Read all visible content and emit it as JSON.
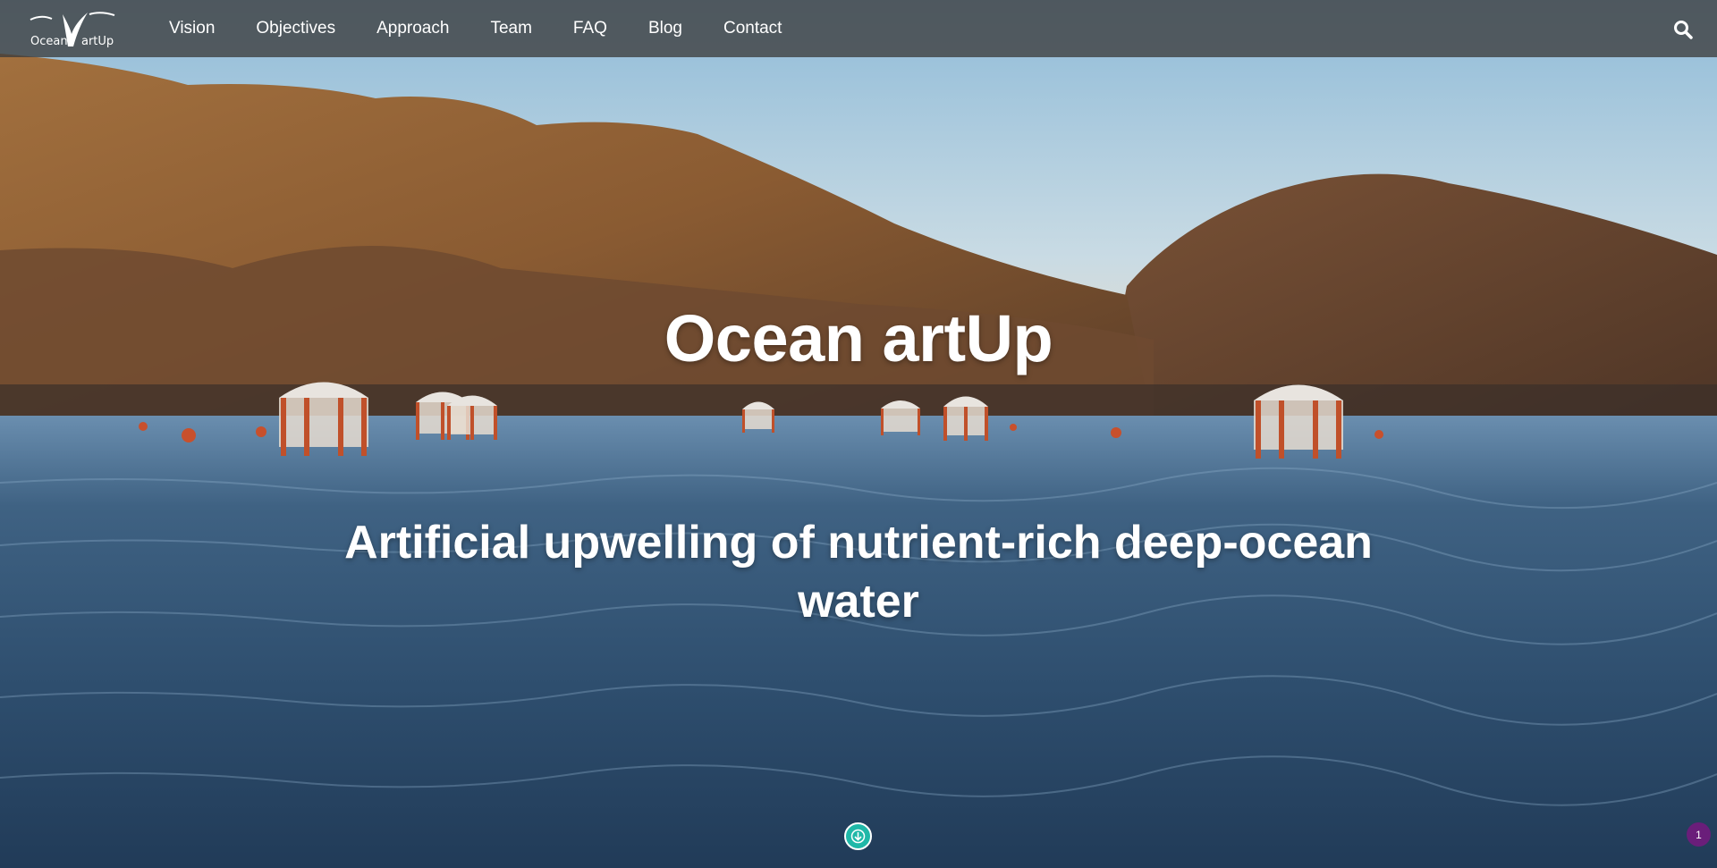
{
  "brand": {
    "logo_text_left": "Ocean",
    "logo_text_right": "artUp"
  },
  "nav": {
    "items": [
      {
        "label": "Vision"
      },
      {
        "label": "Objectives"
      },
      {
        "label": "Approach"
      },
      {
        "label": "Team"
      },
      {
        "label": "FAQ"
      },
      {
        "label": "Blog"
      },
      {
        "label": "Contact"
      }
    ],
    "search_icon": "search-icon"
  },
  "hero": {
    "title": "Ocean artUp",
    "subtitle": "Artificial upwelling of nutrient-rich deep-ocean water",
    "scroll_icon": "arrow-down-circle-icon"
  },
  "notification": {
    "count": "1"
  },
  "colors": {
    "accent": "#20b8a8",
    "badge": "#6a1e7a",
    "nav_bg": "#3c3c3c"
  }
}
